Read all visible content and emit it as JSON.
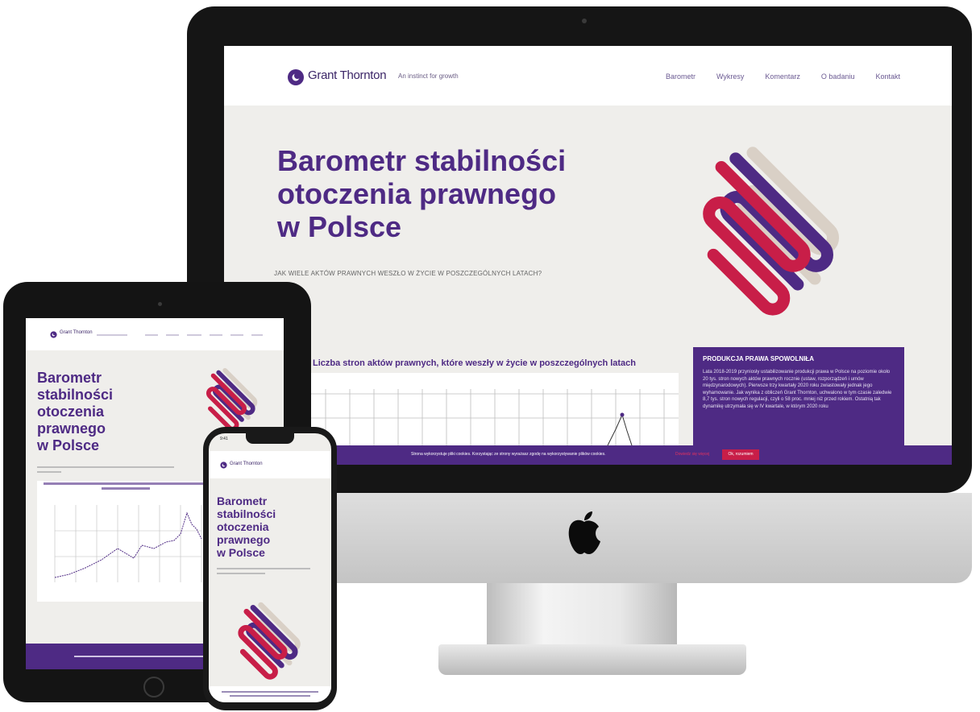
{
  "brand": {
    "name": "Grant Thornton",
    "tagline": "An instinct for growth"
  },
  "nav": {
    "items": [
      "Barometr",
      "Wykresy",
      "Komentarz",
      "O badaniu",
      "Kontakt"
    ]
  },
  "hero": {
    "title_lines": [
      "Barometr stabilności",
      "otoczenia prawnego",
      "w Polsce"
    ],
    "subtitle": "JAK WIELE AKTÓW PRAWNYCH WESZŁO W ŻYCIE W POSZCZEGÓLNYCH LATACH?"
  },
  "chart": {
    "title": "Liczba stron aktów prawnych, które weszły w życie w poszczególnych latach"
  },
  "infobox": {
    "title": "PRODUKCJA PRAWA SPOWOLNIŁA",
    "text": "Lata 2018-2019 przyniosły ustabilizowanie produkcji prawa w Polsce na poziomie około 20 tys. stron nowych aktów prawnych rocznie (ustaw, rozporządzeń i umów międzynarodowych). Pierwsze trzy kwartały 2020 roku zwiastowały jednak jego wyhamowanie. Jak wynika z obliczeń Grant Thornton, uchwalono w tym czasie zaledwie 8,7 tys. stron nowych regulacji, czyli o 58 proc. mniej niż przed rokiem. Ostatnią tak dynamikę utrzymała się w IV kwartale, w którym 2020 roku"
  },
  "cookie": {
    "text": "Strona wykorzystuje pliki cookies. Korzystając ze strony wyrażasz zgodę na wykorzystywanie plików cookies.",
    "link": "Dowiedz się więcej",
    "button": "Ok, rozumiem"
  },
  "ipad": {
    "title_lines": [
      "Barometr",
      "stabilności",
      "otoczenia",
      "prawnego",
      "w Polsce"
    ]
  },
  "iphone": {
    "time": "9:41",
    "title_lines": [
      "Barometr",
      "stabilności",
      "otoczenia",
      "prawnego",
      "w Polsce"
    ]
  },
  "colors": {
    "brand_purple": "#4e2a84",
    "brand_red": "#c81e48",
    "beige": "#d9d0c6"
  }
}
